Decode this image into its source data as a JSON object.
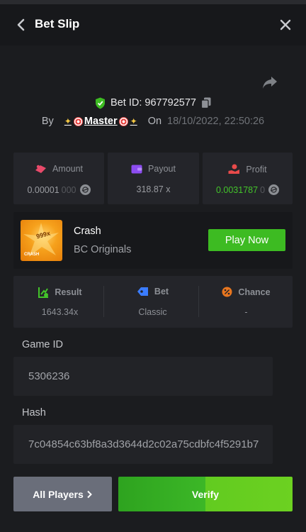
{
  "header": {
    "title": "Bet Slip"
  },
  "bet": {
    "id_label": "Bet ID: 967792577",
    "by_label": "By",
    "username": "Master",
    "on_label": "On",
    "datetime": "18/10/2022, 22:50:26"
  },
  "stats": {
    "amount": {
      "label": "Amount",
      "value_main": "0.00001",
      "value_dim": "000"
    },
    "payout": {
      "label": "Payout",
      "value": "318.87 x"
    },
    "profit": {
      "label": "Profit",
      "value_main": "0.0031787",
      "value_dim": "0"
    }
  },
  "game": {
    "thumb_multiplier": "999x",
    "thumb_title": "CRASH",
    "name": "Crash",
    "provider": "BC Originals",
    "play_label": "Play Now"
  },
  "info": {
    "result": {
      "label": "Result",
      "value": "1643.34x"
    },
    "bet": {
      "label": "Bet",
      "value": "Classic"
    },
    "chance": {
      "label": "Chance",
      "value": "-"
    }
  },
  "game_id": {
    "label": "Game ID",
    "value": "5306236"
  },
  "hash": {
    "label": "Hash",
    "value": "7c04854c63bf8a3d3644d2c02a75cdbfc4f5291b7"
  },
  "actions": {
    "all_players": "All Players",
    "verify": "Verify"
  },
  "colors": {
    "background": "#1b1c1f",
    "accent_green": "#3dbb22",
    "profit_green": "#43c42a",
    "button_gray": "#6a6e7a"
  },
  "icons": [
    "chevron-left-icon",
    "close-icon",
    "share-icon",
    "shield-check-icon",
    "copy-icon",
    "amount-icon",
    "wallet-icon",
    "profit-icon",
    "coin-icon",
    "result-icon",
    "tag-icon",
    "percent-icon",
    "chevron-right-icon"
  ]
}
